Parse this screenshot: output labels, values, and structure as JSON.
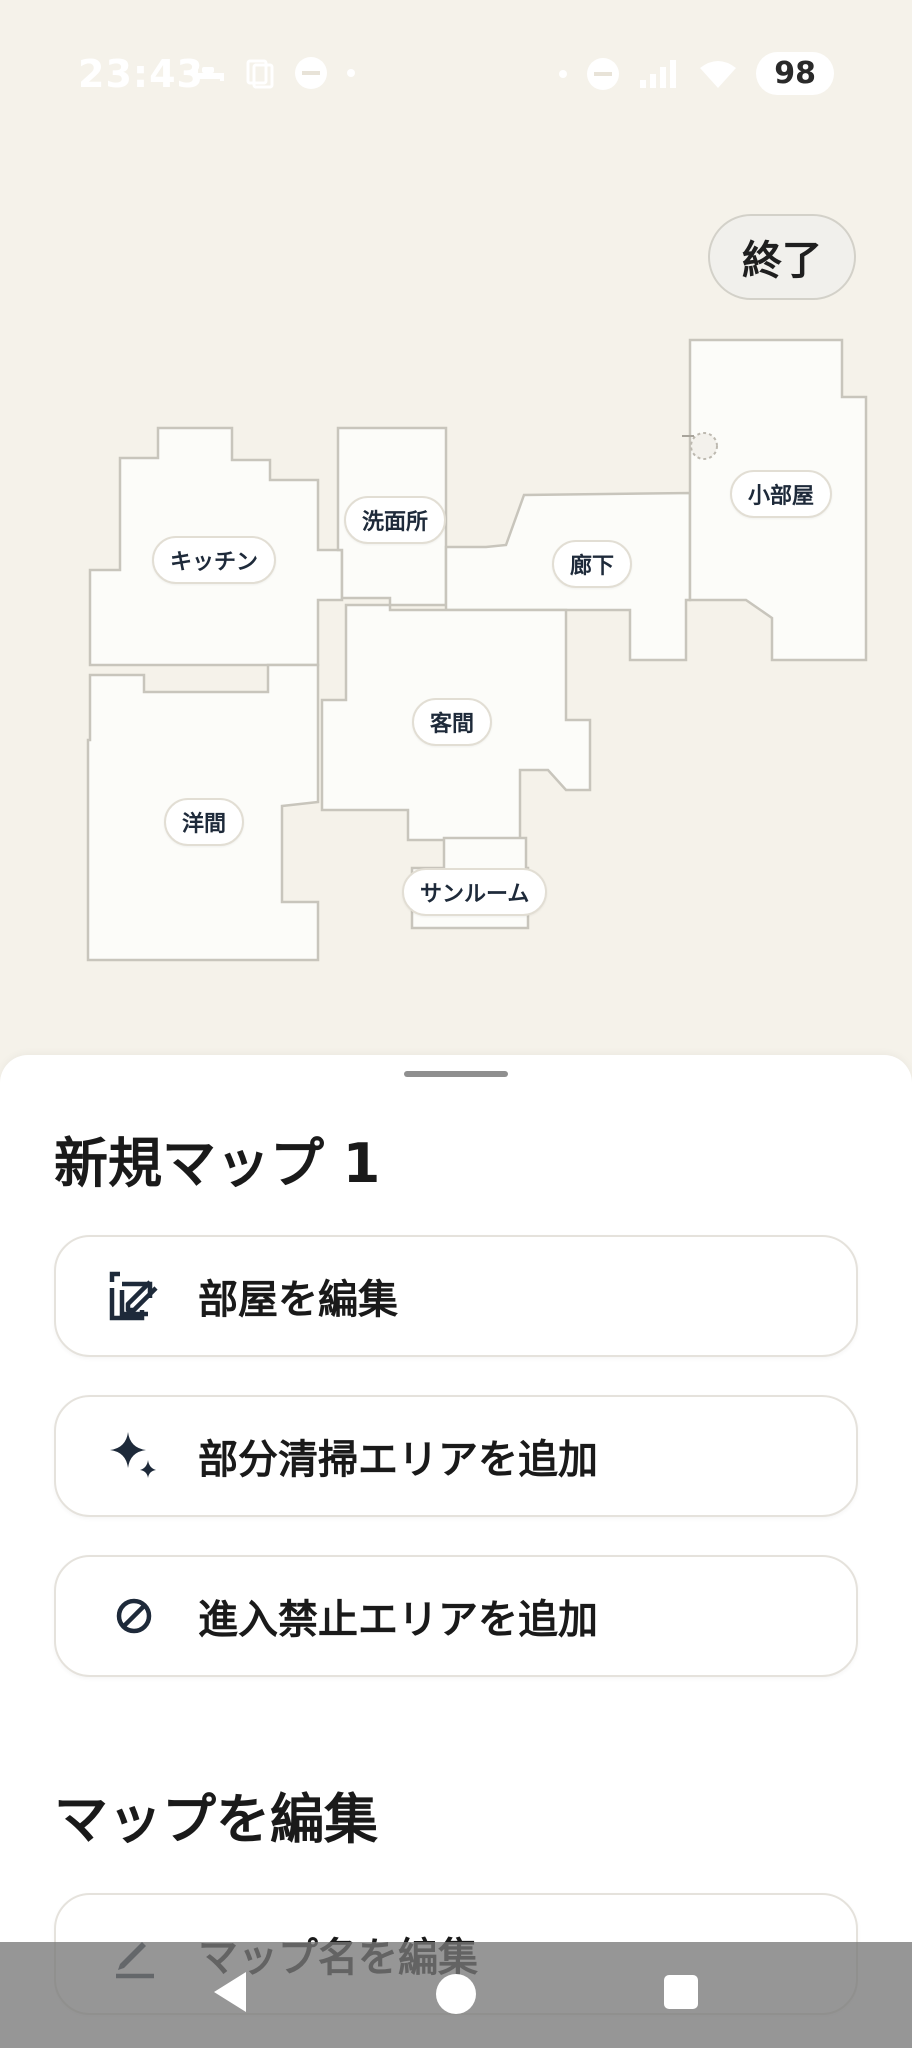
{
  "status_bar": {
    "time": "23:43",
    "battery": "98"
  },
  "map": {
    "finish_label": "終了",
    "rooms": {
      "kitchen": "キッチン",
      "washroom": "洗面所",
      "hallway": "廊下",
      "small_room": "小部屋",
      "living_room": "客間",
      "western_room": "洋間",
      "sunroom": "サンルーム"
    }
  },
  "sheet": {
    "title": "新規マップ 1",
    "actions": [
      {
        "label": "部屋を編集",
        "icon": "edit-square-icon"
      },
      {
        "label": "部分清掃エリアを追加",
        "icon": "sparkle-icon"
      },
      {
        "label": "進入禁止エリアを追加",
        "icon": "no-entry-icon"
      }
    ],
    "section_title": "マップを編集",
    "map_actions": [
      {
        "label": "マップ名を編集",
        "icon": "pencil-icon"
      }
    ]
  },
  "colors": {
    "map_background": "#f5f2ea",
    "room_fill": "#fcfcf9",
    "room_stroke": "#c8c5bc",
    "label_text": "#1e2a3a"
  }
}
